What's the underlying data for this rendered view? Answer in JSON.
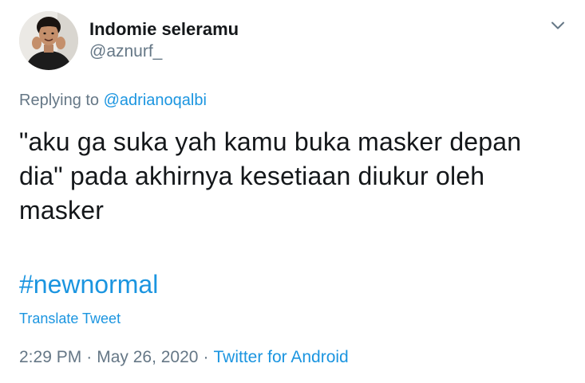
{
  "tweet": {
    "author": {
      "display_name": "Indomie seleramu",
      "handle": "@aznurf_",
      "avatar_icon": "user-avatar"
    },
    "menu_icon": "chevron-down-icon",
    "replying_prefix": "Replying to",
    "replying_to": "@adrianoqalbi",
    "text": "\"aku ga suka yah kamu buka masker depan dia\" pada akhirnya kesetiaan diukur oleh masker",
    "hashtag": "#newnormal",
    "translate_label": "Translate Tweet",
    "time": "2:29 PM",
    "separator": "·",
    "date": "May 26, 2020",
    "source": "Twitter for Android"
  },
  "colors": {
    "text": "#14171a",
    "secondary": "#657786",
    "link": "#1b95e0",
    "background": "#ffffff"
  }
}
